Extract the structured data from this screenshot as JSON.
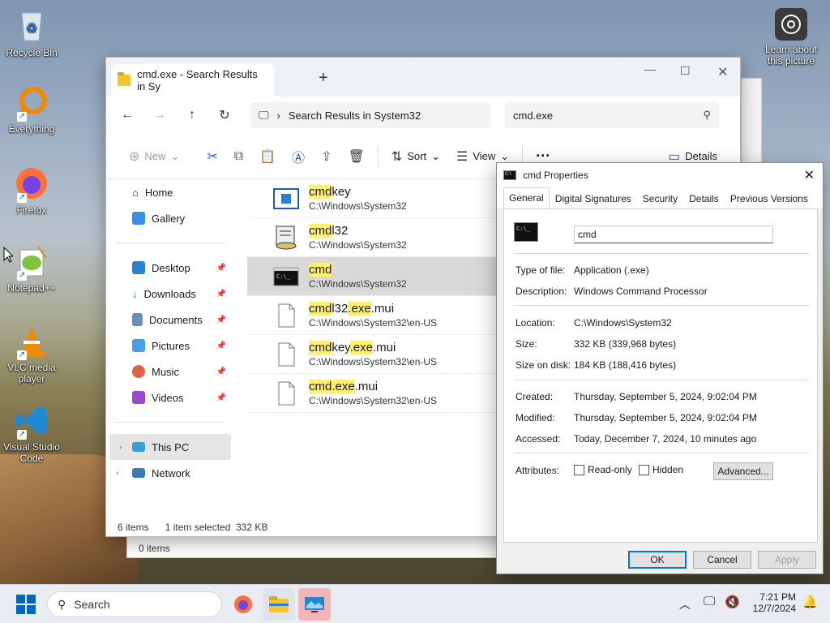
{
  "desktop": {
    "icons": [
      {
        "label": "Recycle Bin"
      },
      {
        "label": "Everything"
      },
      {
        "label": "Firefox"
      },
      {
        "label": "Notepad++"
      },
      {
        "label": "VLC media player"
      },
      {
        "label": "Visual Studio Code"
      }
    ],
    "learn_label": "Learn about this picture"
  },
  "explorer": {
    "tab_title": "cmd.exe - Search Results in Sy",
    "address": "Search Results in System32",
    "search_value": "cmd.exe",
    "toolbar": {
      "new": "New",
      "sort": "Sort",
      "view": "View",
      "details": "Details"
    },
    "sidebar": {
      "home": "Home",
      "gallery": "Gallery",
      "desktop": "Desktop",
      "downloads": "Downloads",
      "documents": "Documents",
      "pictures": "Pictures",
      "music": "Music",
      "videos": "Videos",
      "thispc": "This PC",
      "network": "Network"
    },
    "files": [
      {
        "hl": "cmd",
        "rest": "key",
        "path": "C:\\Windows\\System32"
      },
      {
        "hl": "cmd",
        "rest": "l32",
        "path": "C:\\Windows\\System32"
      },
      {
        "hl": "cmd",
        "rest": "",
        "path": "C:\\Windows\\System32"
      },
      {
        "hl": "cmd",
        "mid": "l32",
        "hl2": ".exe",
        "rest": ".mui",
        "path": "C:\\Windows\\System32\\en-US"
      },
      {
        "hl": "cmd",
        "mid": "key",
        "hl2": ".exe",
        "rest": ".mui",
        "path": "C:\\Windows\\System32\\en-US"
      },
      {
        "hl": "cmd.exe",
        "rest": ".mui",
        "path": "C:\\Windows\\System32\\en-US"
      }
    ],
    "status": {
      "count": "6 items",
      "selected": "1 item selected",
      "size": "332 KB"
    },
    "behind_status": "0 items"
  },
  "properties": {
    "title": "cmd Properties",
    "tabs": [
      "General",
      "Digital Signatures",
      "Security",
      "Details",
      "Previous Versions"
    ],
    "name_value": "cmd",
    "type_label": "Type of file:",
    "type_value": "Application (.exe)",
    "desc_label": "Description:",
    "desc_value": "Windows Command Processor",
    "loc_label": "Location:",
    "loc_value": "C:\\Windows\\System32",
    "size_label": "Size:",
    "size_value": "332 KB (339,968 bytes)",
    "disk_label": "Size on disk:",
    "disk_value": "184 KB (188,416 bytes)",
    "created_label": "Created:",
    "created_value": "Thursday, September 5, 2024, 9:02:04 PM",
    "modified_label": "Modified:",
    "modified_value": "Thursday, September 5, 2024, 9:02:04 PM",
    "accessed_label": "Accessed:",
    "accessed_value": "Today, December 7, 2024, 10 minutes ago",
    "attr_label": "Attributes:",
    "readonly": "Read-only",
    "hidden": "Hidden",
    "advanced": "Advanced...",
    "ok": "OK",
    "cancel": "Cancel",
    "apply": "Apply"
  },
  "taskbar": {
    "search": "Search",
    "time": "7:21 PM",
    "date": "12/7/2024"
  }
}
